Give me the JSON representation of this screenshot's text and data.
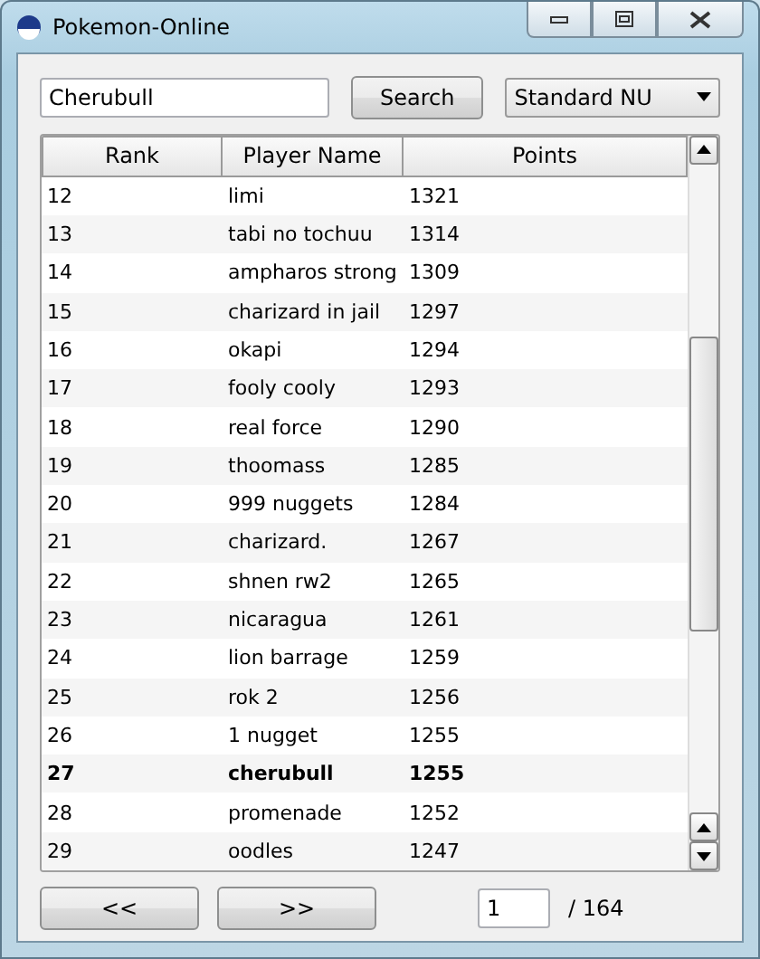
{
  "window": {
    "title": "Pokemon-Online"
  },
  "search": {
    "value": "Cherubull",
    "button": "Search"
  },
  "tier": {
    "value": "Standard NU"
  },
  "table": {
    "columns": [
      "Rank",
      "Player Name",
      "Points"
    ],
    "rows": [
      {
        "rank": "12",
        "name": "limi",
        "points": "1321",
        "highlighted": false
      },
      {
        "rank": "13",
        "name": "tabi no tochuu",
        "points": "1314",
        "highlighted": false
      },
      {
        "rank": "14",
        "name": "ampharos strong",
        "points": "1309",
        "highlighted": false
      },
      {
        "rank": "15",
        "name": "charizard in jail",
        "points": "1297",
        "highlighted": false
      },
      {
        "rank": "16",
        "name": "okapi",
        "points": "1294",
        "highlighted": false
      },
      {
        "rank": "17",
        "name": "fooly cooly",
        "points": "1293",
        "highlighted": false
      },
      {
        "rank": "18",
        "name": "real force",
        "points": "1290",
        "highlighted": false
      },
      {
        "rank": "19",
        "name": "thoomass",
        "points": "1285",
        "highlighted": false
      },
      {
        "rank": "20",
        "name": "999 nuggets",
        "points": "1284",
        "highlighted": false
      },
      {
        "rank": "21",
        "name": "charizard.",
        "points": "1267",
        "highlighted": false
      },
      {
        "rank": "22",
        "name": "shnen rw2",
        "points": "1265",
        "highlighted": false
      },
      {
        "rank": "23",
        "name": "nicaragua",
        "points": "1261",
        "highlighted": false
      },
      {
        "rank": "24",
        "name": "lion barrage",
        "points": "1259",
        "highlighted": false
      },
      {
        "rank": "25",
        "name": "rok 2",
        "points": "1256",
        "highlighted": false
      },
      {
        "rank": "26",
        "name": "1 nugget",
        "points": "1255",
        "highlighted": false
      },
      {
        "rank": "27",
        "name": "cherubull",
        "points": "1255",
        "highlighted": true
      },
      {
        "rank": "28",
        "name": "promenade",
        "points": "1252",
        "highlighted": false
      },
      {
        "rank": "29",
        "name": "oodles",
        "points": "1247",
        "highlighted": false
      }
    ]
  },
  "pager": {
    "previous": "<<",
    "next": ">>",
    "page": "1",
    "total": "/ 164"
  }
}
